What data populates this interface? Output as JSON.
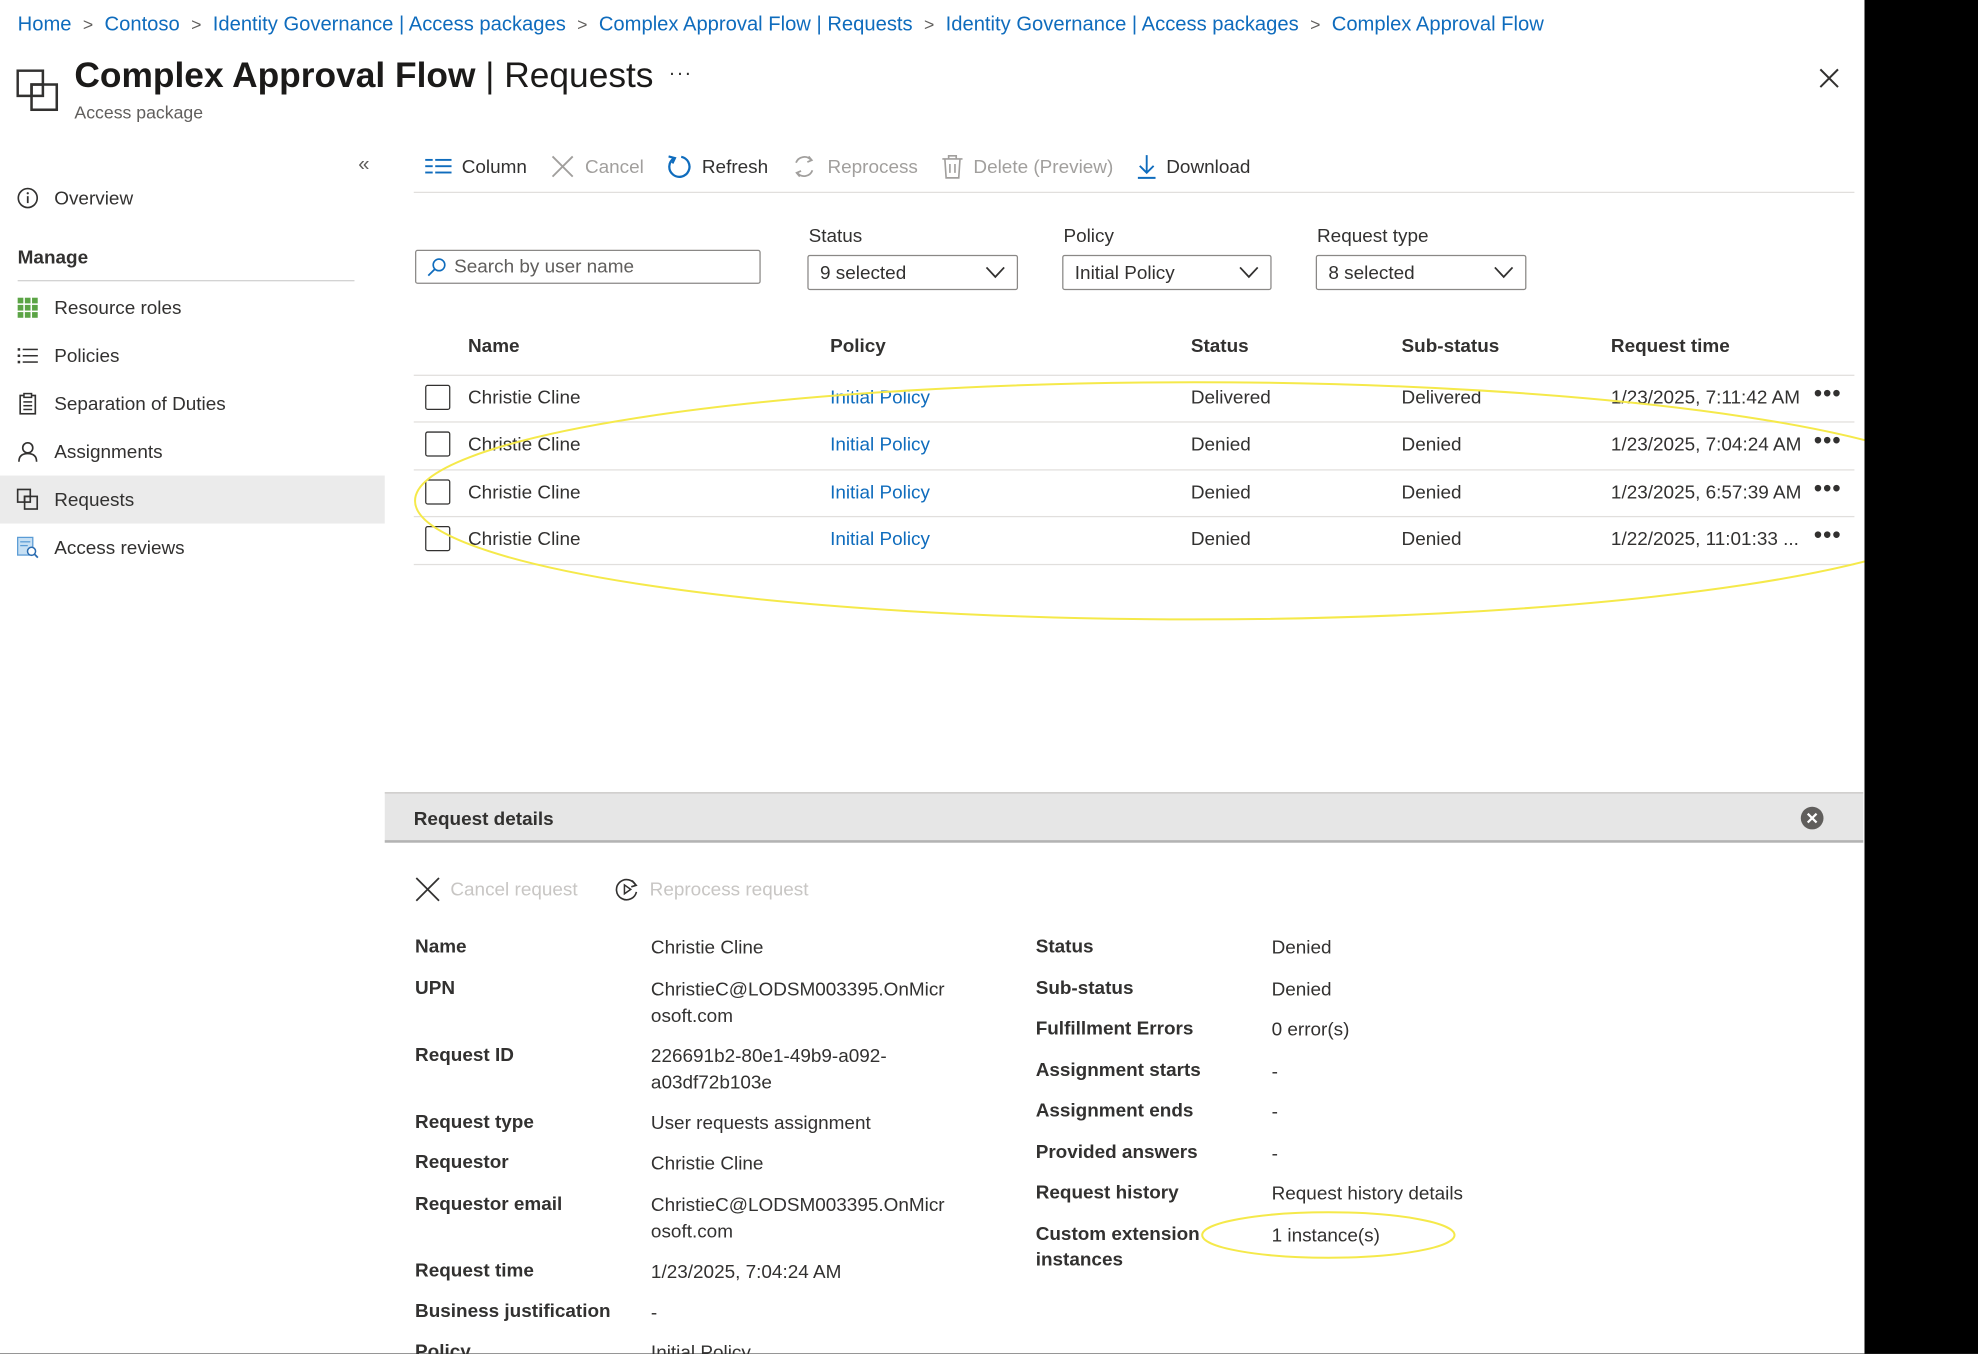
{
  "breadcrumb": [
    "Home",
    "Contoso",
    "Identity Governance | Access packages",
    "Complex Approval Flow | Requests",
    "Identity Governance | Access packages",
    "Complex Approval Flow"
  ],
  "header": {
    "title_bold": "Complex Approval Flow",
    "title_rest": " | Requests",
    "subtitle": "Access package",
    "more": "···"
  },
  "sidebar": {
    "collapse": "«",
    "overview": "Overview",
    "manage_heading": "Manage",
    "items": [
      {
        "label": "Resource roles",
        "icon": "grid-icon"
      },
      {
        "label": "Policies",
        "icon": "list-icon"
      },
      {
        "label": "Separation of Duties",
        "icon": "clipboard-icon"
      },
      {
        "label": "Assignments",
        "icon": "person-icon"
      },
      {
        "label": "Requests",
        "icon": "package-icon",
        "active": true
      },
      {
        "label": "Access reviews",
        "icon": "review-icon"
      }
    ]
  },
  "toolbar": {
    "column": "Column",
    "cancel": "Cancel",
    "refresh": "Refresh",
    "reprocess": "Reprocess",
    "delete": "Delete (Preview)",
    "download": "Download"
  },
  "filters": {
    "search_placeholder": "Search by user name",
    "status_label": "Status",
    "status_value": "9 selected",
    "policy_label": "Policy",
    "policy_value": "Initial Policy",
    "reqtype_label": "Request type",
    "reqtype_value": "8 selected"
  },
  "table": {
    "headers": [
      "Name",
      "Policy",
      "Status",
      "Sub-status",
      "Request time"
    ],
    "rows": [
      {
        "name": "Christie Cline",
        "policy": "Initial Policy",
        "status": "Delivered",
        "substatus": "Delivered",
        "time": "1/23/2025, 7:11:42 AM"
      },
      {
        "name": "Christie Cline",
        "policy": "Initial Policy",
        "status": "Denied",
        "substatus": "Denied",
        "time": "1/23/2025, 7:04:24 AM"
      },
      {
        "name": "Christie Cline",
        "policy": "Initial Policy",
        "status": "Denied",
        "substatus": "Denied",
        "time": "1/23/2025, 6:57:39 AM"
      },
      {
        "name": "Christie Cline",
        "policy": "Initial Policy",
        "status": "Denied",
        "substatus": "Denied",
        "time": "1/22/2025, 11:01:33 ..."
      }
    ],
    "row_more": "•••"
  },
  "details": {
    "title": "Request details",
    "cancel_request": "Cancel request",
    "reprocess_request": "Reprocess request",
    "left": [
      {
        "key": "Name",
        "value": "Christie Cline"
      },
      {
        "key": "UPN",
        "value": "ChristieC@LODSM003395.OnMicr\nosoft.com"
      },
      {
        "key": "Request ID",
        "value": "226691b2-80e1-49b9-a092-\na03df72b103e"
      },
      {
        "key": "Request type",
        "value": "User requests assignment"
      },
      {
        "key": "Requestor",
        "value": "Christie Cline"
      },
      {
        "key": "Requestor email",
        "value": "ChristieC@LODSM003395.OnMicr\nosoft.com"
      },
      {
        "key": "Request time",
        "value": "1/23/2025, 7:04:24 AM"
      },
      {
        "key": "Business justification",
        "value": "-"
      },
      {
        "key": "Policy",
        "value": "Initial Policy"
      }
    ],
    "right": [
      {
        "key": "Status",
        "value": "Denied"
      },
      {
        "key": "Sub-status",
        "value": "Denied"
      },
      {
        "key": "Fulfillment Errors",
        "value": "0 error(s)"
      },
      {
        "key": "Assignment starts",
        "value": "-"
      },
      {
        "key": "Assignment ends",
        "value": "-"
      },
      {
        "key": "Provided answers",
        "value": "-"
      },
      {
        "key": "Request history",
        "value": "Request history details"
      },
      {
        "key": "Custom extension\ninstances",
        "value": "1 instance(s)"
      }
    ]
  },
  "colors": {
    "link": "#0f6cbd",
    "annotation": "#f5e94a",
    "nav_active": "#ebebeb"
  }
}
